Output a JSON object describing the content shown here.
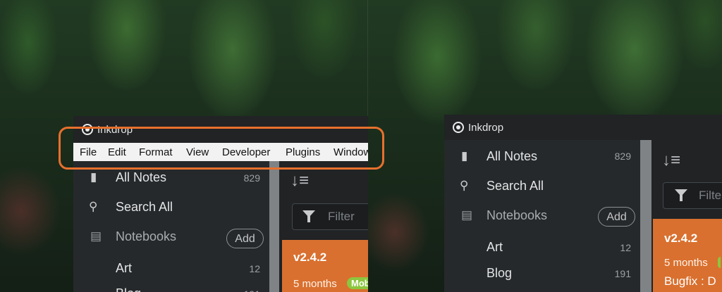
{
  "app": {
    "title": "Inkdrop"
  },
  "menu": {
    "items": [
      "File",
      "Edit",
      "Format",
      "View",
      "Developer",
      "Plugins",
      "Window"
    ]
  },
  "sidebar": {
    "all_notes": {
      "label": "All Notes",
      "count": "829",
      "icon": "document-icon"
    },
    "search_all": {
      "label": "Search All",
      "icon": "search-icon"
    },
    "notebooks": {
      "label": "Notebooks",
      "add_label": "Add",
      "icon": "book-icon"
    },
    "notebook_items": [
      {
        "label": "Art",
        "count": "12"
      },
      {
        "label": "Blog",
        "count": "191"
      }
    ]
  },
  "notes": {
    "filter_placeholder": "Filter",
    "filter_placeholder_short": "Filte",
    "card": {
      "version": "v2.4.2",
      "time": "5 months",
      "tag": "Mob",
      "body": "Bugfix : D"
    }
  },
  "colors": {
    "accent_orange": "#e8702c",
    "note_card": "#d9702f",
    "tag_green": "#8cc63f"
  }
}
